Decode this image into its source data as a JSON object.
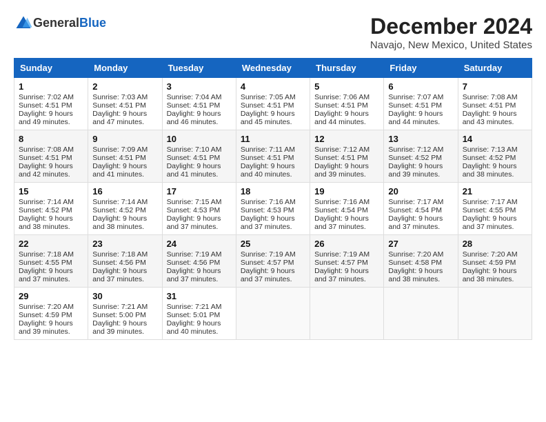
{
  "header": {
    "logo_general": "General",
    "logo_blue": "Blue",
    "title": "December 2024",
    "subtitle": "Navajo, New Mexico, United States"
  },
  "calendar": {
    "days_of_week": [
      "Sunday",
      "Monday",
      "Tuesday",
      "Wednesday",
      "Thursday",
      "Friday",
      "Saturday"
    ],
    "weeks": [
      [
        {
          "day": "1",
          "sunrise": "7:02 AM",
          "sunset": "4:51 PM",
          "daylight": "9 hours and 49 minutes."
        },
        {
          "day": "2",
          "sunrise": "7:03 AM",
          "sunset": "4:51 PM",
          "daylight": "9 hours and 47 minutes."
        },
        {
          "day": "3",
          "sunrise": "7:04 AM",
          "sunset": "4:51 PM",
          "daylight": "9 hours and 46 minutes."
        },
        {
          "day": "4",
          "sunrise": "7:05 AM",
          "sunset": "4:51 PM",
          "daylight": "9 hours and 45 minutes."
        },
        {
          "day": "5",
          "sunrise": "7:06 AM",
          "sunset": "4:51 PM",
          "daylight": "9 hours and 44 minutes."
        },
        {
          "day": "6",
          "sunrise": "7:07 AM",
          "sunset": "4:51 PM",
          "daylight": "9 hours and 44 minutes."
        },
        {
          "day": "7",
          "sunrise": "7:08 AM",
          "sunset": "4:51 PM",
          "daylight": "9 hours and 43 minutes."
        }
      ],
      [
        {
          "day": "8",
          "sunrise": "7:08 AM",
          "sunset": "4:51 PM",
          "daylight": "9 hours and 42 minutes."
        },
        {
          "day": "9",
          "sunrise": "7:09 AM",
          "sunset": "4:51 PM",
          "daylight": "9 hours and 41 minutes."
        },
        {
          "day": "10",
          "sunrise": "7:10 AM",
          "sunset": "4:51 PM",
          "daylight": "9 hours and 41 minutes."
        },
        {
          "day": "11",
          "sunrise": "7:11 AM",
          "sunset": "4:51 PM",
          "daylight": "9 hours and 40 minutes."
        },
        {
          "day": "12",
          "sunrise": "7:12 AM",
          "sunset": "4:51 PM",
          "daylight": "9 hours and 39 minutes."
        },
        {
          "day": "13",
          "sunrise": "7:12 AM",
          "sunset": "4:52 PM",
          "daylight": "9 hours and 39 minutes."
        },
        {
          "day": "14",
          "sunrise": "7:13 AM",
          "sunset": "4:52 PM",
          "daylight": "9 hours and 38 minutes."
        }
      ],
      [
        {
          "day": "15",
          "sunrise": "7:14 AM",
          "sunset": "4:52 PM",
          "daylight": "9 hours and 38 minutes."
        },
        {
          "day": "16",
          "sunrise": "7:14 AM",
          "sunset": "4:52 PM",
          "daylight": "9 hours and 38 minutes."
        },
        {
          "day": "17",
          "sunrise": "7:15 AM",
          "sunset": "4:53 PM",
          "daylight": "9 hours and 37 minutes."
        },
        {
          "day": "18",
          "sunrise": "7:16 AM",
          "sunset": "4:53 PM",
          "daylight": "9 hours and 37 minutes."
        },
        {
          "day": "19",
          "sunrise": "7:16 AM",
          "sunset": "4:54 PM",
          "daylight": "9 hours and 37 minutes."
        },
        {
          "day": "20",
          "sunrise": "7:17 AM",
          "sunset": "4:54 PM",
          "daylight": "9 hours and 37 minutes."
        },
        {
          "day": "21",
          "sunrise": "7:17 AM",
          "sunset": "4:55 PM",
          "daylight": "9 hours and 37 minutes."
        }
      ],
      [
        {
          "day": "22",
          "sunrise": "7:18 AM",
          "sunset": "4:55 PM",
          "daylight": "9 hours and 37 minutes."
        },
        {
          "day": "23",
          "sunrise": "7:18 AM",
          "sunset": "4:56 PM",
          "daylight": "9 hours and 37 minutes."
        },
        {
          "day": "24",
          "sunrise": "7:19 AM",
          "sunset": "4:56 PM",
          "daylight": "9 hours and 37 minutes."
        },
        {
          "day": "25",
          "sunrise": "7:19 AM",
          "sunset": "4:57 PM",
          "daylight": "9 hours and 37 minutes."
        },
        {
          "day": "26",
          "sunrise": "7:19 AM",
          "sunset": "4:57 PM",
          "daylight": "9 hours and 37 minutes."
        },
        {
          "day": "27",
          "sunrise": "7:20 AM",
          "sunset": "4:58 PM",
          "daylight": "9 hours and 38 minutes."
        },
        {
          "day": "28",
          "sunrise": "7:20 AM",
          "sunset": "4:59 PM",
          "daylight": "9 hours and 38 minutes."
        }
      ],
      [
        {
          "day": "29",
          "sunrise": "7:20 AM",
          "sunset": "4:59 PM",
          "daylight": "9 hours and 39 minutes."
        },
        {
          "day": "30",
          "sunrise": "7:21 AM",
          "sunset": "5:00 PM",
          "daylight": "9 hours and 39 minutes."
        },
        {
          "day": "31",
          "sunrise": "7:21 AM",
          "sunset": "5:01 PM",
          "daylight": "9 hours and 40 minutes."
        },
        null,
        null,
        null,
        null
      ]
    ]
  }
}
